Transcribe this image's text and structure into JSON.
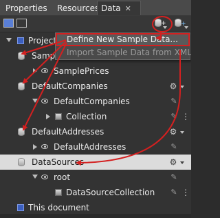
{
  "tabs": [
    {
      "label": "Properties"
    },
    {
      "label": "Resources"
    },
    {
      "label": "Data",
      "active": true,
      "close": "✕"
    }
  ],
  "tree": {
    "project": "Project",
    "sample_prefix": "Sampl",
    "sample_prices": "SamplePrices",
    "default_companies": "DefaultCompanies",
    "default_companies_child": "DefaultCompanies",
    "collection": "Collection",
    "default_addresses": "DefaultAddresses",
    "default_addresses_child": "DefaultAddresses",
    "data_sources": "DataSources",
    "root": "root",
    "data_source_collection": "DataSourceCollection",
    "this_document": "This document"
  },
  "menu": {
    "items": [
      {
        "label": "Define New Sample Data...",
        "enabled": true
      },
      {
        "label": "Import Sample Data from XML...",
        "enabled": false
      }
    ]
  },
  "colors": {
    "annotation": "#d42020",
    "selected_row": "#dcdcdc",
    "panel_bg": "#333333"
  },
  "icons": {
    "db": "database-icon",
    "eye": "eye-icon",
    "box": "collection-icon",
    "project": "project-icon",
    "pencil": "edit-icon"
  }
}
